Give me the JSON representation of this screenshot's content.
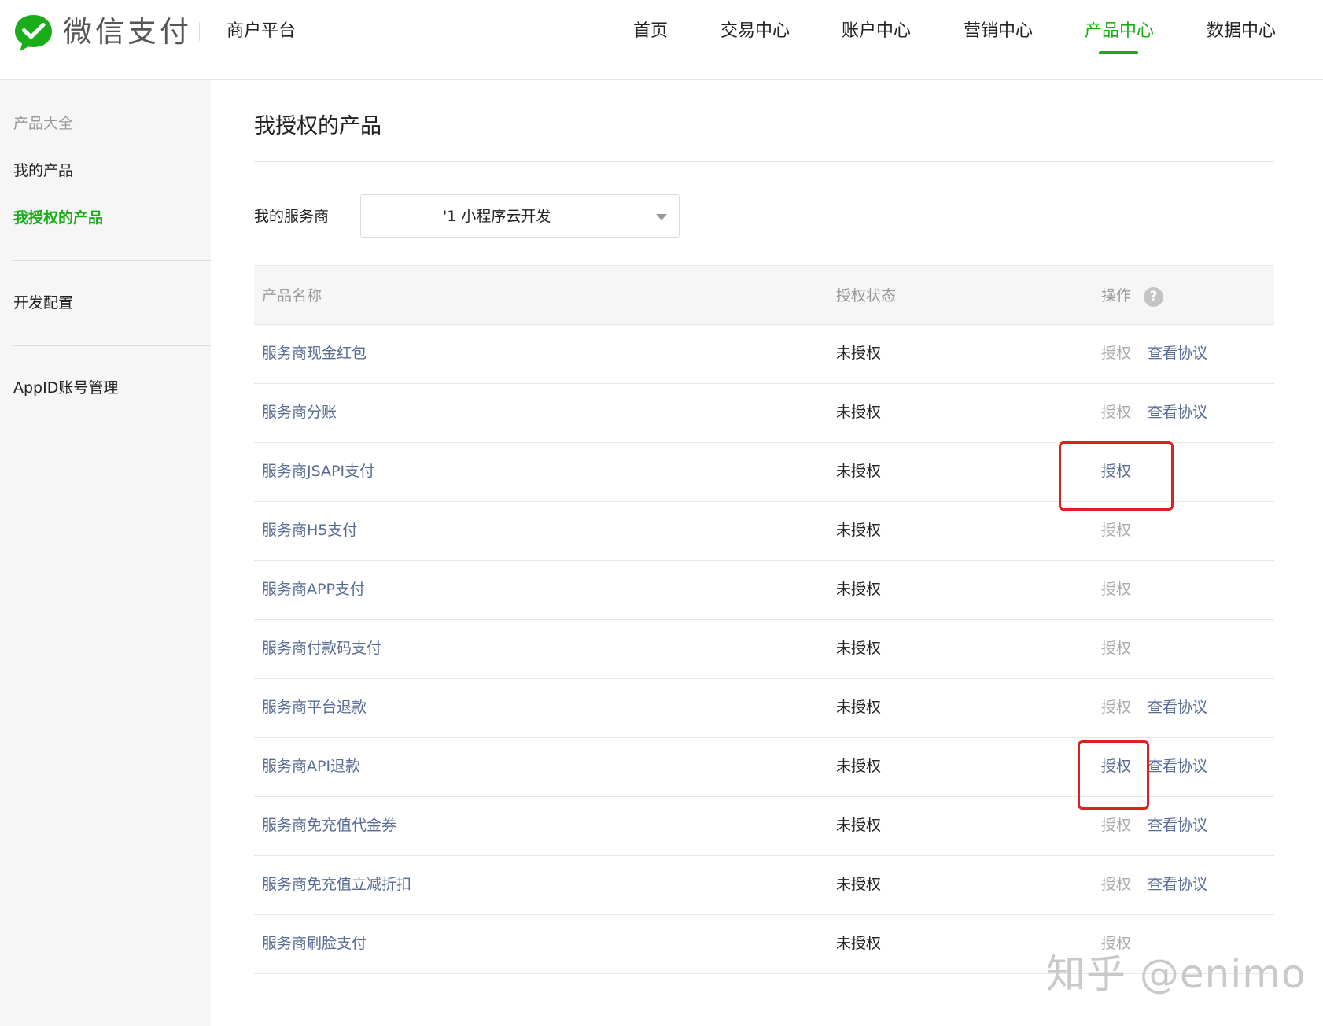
{
  "header": {
    "brand_name": "微信支付",
    "platform": "商户平台",
    "nav": [
      {
        "label": "首页",
        "active": false
      },
      {
        "label": "交易中心",
        "active": false
      },
      {
        "label": "账户中心",
        "active": false
      },
      {
        "label": "营销中心",
        "active": false
      },
      {
        "label": "产品中心",
        "active": true
      },
      {
        "label": "数据中心",
        "active": false
      }
    ],
    "accent_color": "#1aad19"
  },
  "sidebar": {
    "items": [
      {
        "label": "产品大全",
        "state": "group"
      },
      {
        "label": "我的产品",
        "state": "normal"
      },
      {
        "label": "我授权的产品",
        "state": "active"
      },
      {
        "label": "开发配置",
        "state": "normal"
      },
      {
        "label": "AppID账号管理",
        "state": "normal"
      }
    ]
  },
  "main": {
    "title": "我授权的产品",
    "filter": {
      "label": "我的服务商",
      "value": "'1 小程序云开发"
    },
    "table": {
      "columns": [
        "产品名称",
        "授权状态",
        "操作"
      ],
      "help_icon": "question-icon",
      "rows": [
        {
          "name": "服务商现金红包",
          "status": "未授权",
          "auth": "授权",
          "auth_enabled": false,
          "agreement": "查看协议",
          "highlighted": false
        },
        {
          "name": "服务商分账",
          "status": "未授权",
          "auth": "授权",
          "auth_enabled": false,
          "agreement": "查看协议",
          "highlighted": false
        },
        {
          "name": "服务商JSAPI支付",
          "status": "未授权",
          "auth": "授权",
          "auth_enabled": true,
          "agreement": "",
          "highlighted": true
        },
        {
          "name": "服务商H5支付",
          "status": "未授权",
          "auth": "授权",
          "auth_enabled": false,
          "agreement": "",
          "highlighted": false
        },
        {
          "name": "服务商APP支付",
          "status": "未授权",
          "auth": "授权",
          "auth_enabled": false,
          "agreement": "",
          "highlighted": false
        },
        {
          "name": "服务商付款码支付",
          "status": "未授权",
          "auth": "授权",
          "auth_enabled": false,
          "agreement": "",
          "highlighted": false
        },
        {
          "name": "服务商平台退款",
          "status": "未授权",
          "auth": "授权",
          "auth_enabled": false,
          "agreement": "查看协议",
          "highlighted": false
        },
        {
          "name": "服务商API退款",
          "status": "未授权",
          "auth": "授权",
          "auth_enabled": true,
          "agreement": "查看协议",
          "highlighted": true
        },
        {
          "name": "服务商免充值代金券",
          "status": "未授权",
          "auth": "授权",
          "auth_enabled": false,
          "agreement": "查看协议",
          "highlighted": false
        },
        {
          "name": "服务商免充值立减折扣",
          "status": "未授权",
          "auth": "授权",
          "auth_enabled": false,
          "agreement": "查看协议",
          "highlighted": false
        },
        {
          "name": "服务商刷脸支付",
          "status": "未授权",
          "auth": "授权",
          "auth_enabled": false,
          "agreement": "",
          "highlighted": false
        }
      ]
    }
  },
  "watermark": "知乎 @enimo",
  "colors": {
    "link": "#576b95",
    "disabled": "#aaaaaa",
    "highlight_box": "#e02020"
  }
}
